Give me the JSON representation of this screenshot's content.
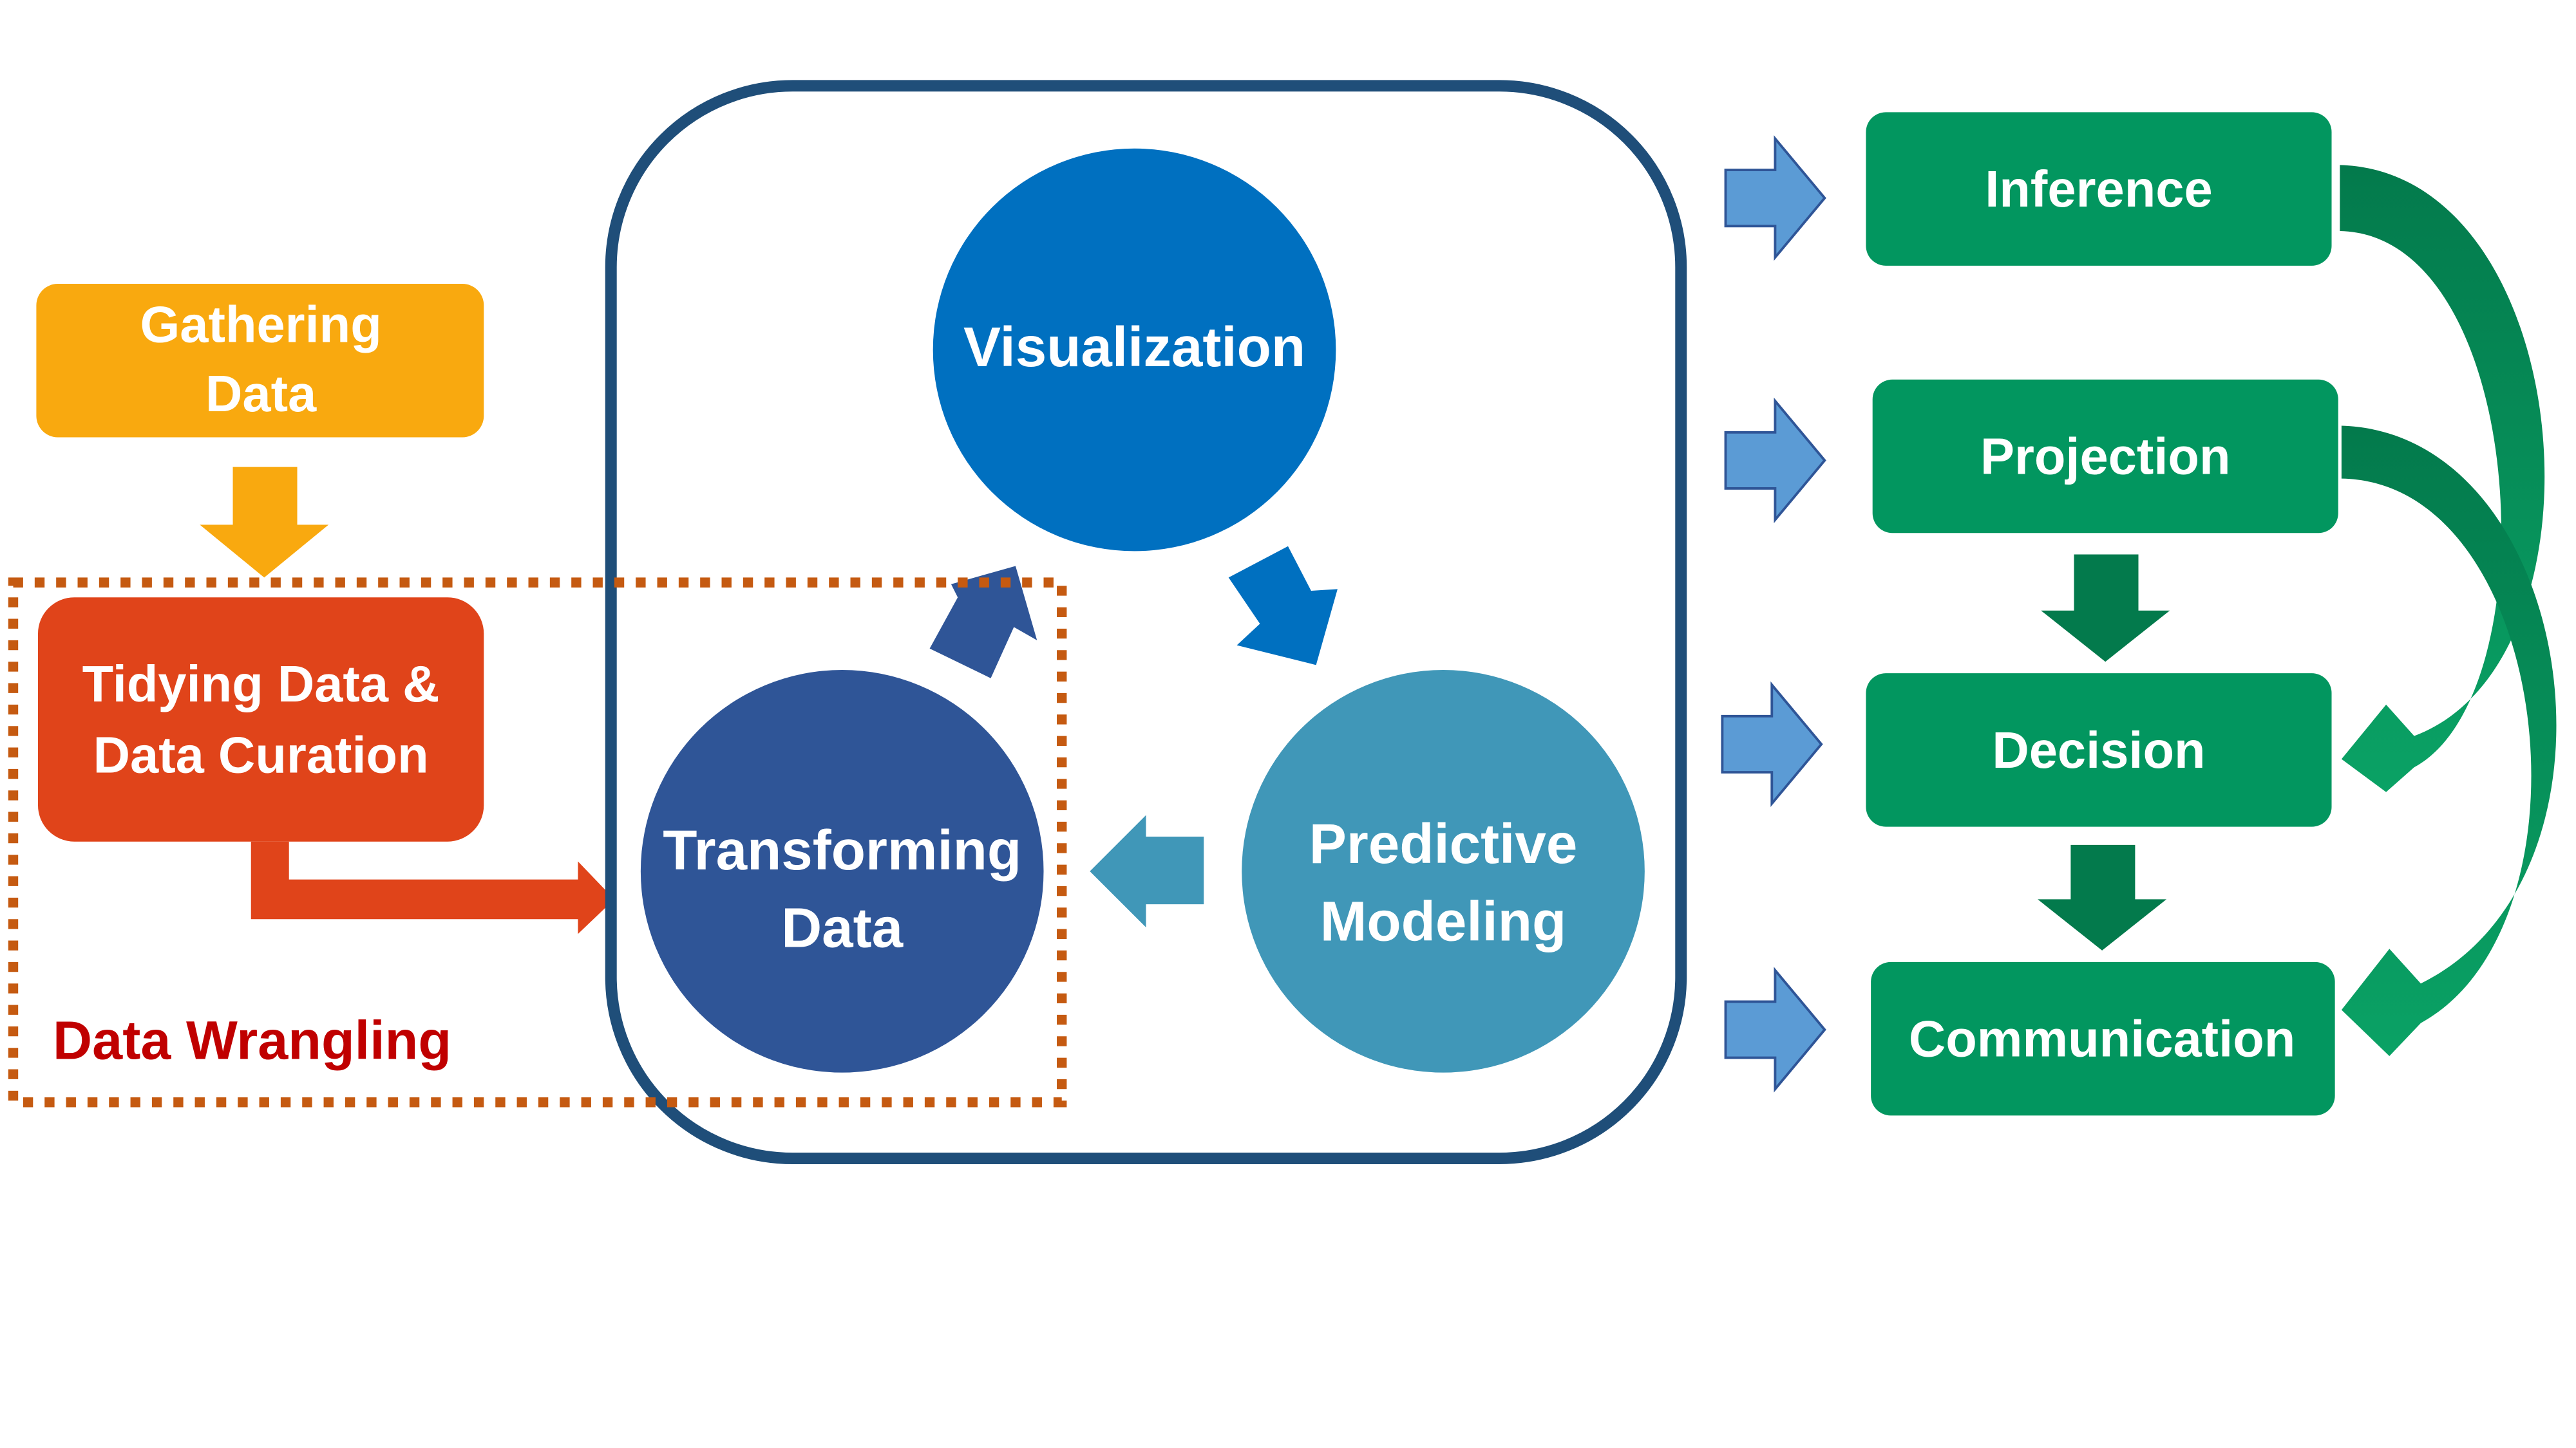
{
  "colors": {
    "gathering": "#F9A90F",
    "tidying": "#E0441A",
    "wrangling_border": "#C55A11",
    "wrangling_label": "#C00000",
    "cycle_border": "#1F4E79",
    "visualization": "#0070C0",
    "transforming": "#2F5597",
    "predictive": "#4097B8",
    "right_arrow": "#5B9BD5",
    "outcome_box": "#02965F",
    "outcome_arrow": "#037A4C"
  },
  "gathering": {
    "lines": [
      "Gathering",
      "Data"
    ]
  },
  "tidying": {
    "lines": [
      "Tidying Data &",
      "Data Curation"
    ]
  },
  "wrangling": {
    "label": "Data Wrangling"
  },
  "cycle": {
    "visualization": {
      "lines": [
        "Visualization"
      ]
    },
    "transforming": {
      "lines": [
        "Transforming",
        "Data"
      ]
    },
    "predictive": {
      "lines": [
        "Predictive",
        "Modeling"
      ]
    }
  },
  "outcomes": [
    {
      "label": "Inference"
    },
    {
      "label": "Projection"
    },
    {
      "label": "Decision"
    },
    {
      "label": "Communication"
    }
  ]
}
